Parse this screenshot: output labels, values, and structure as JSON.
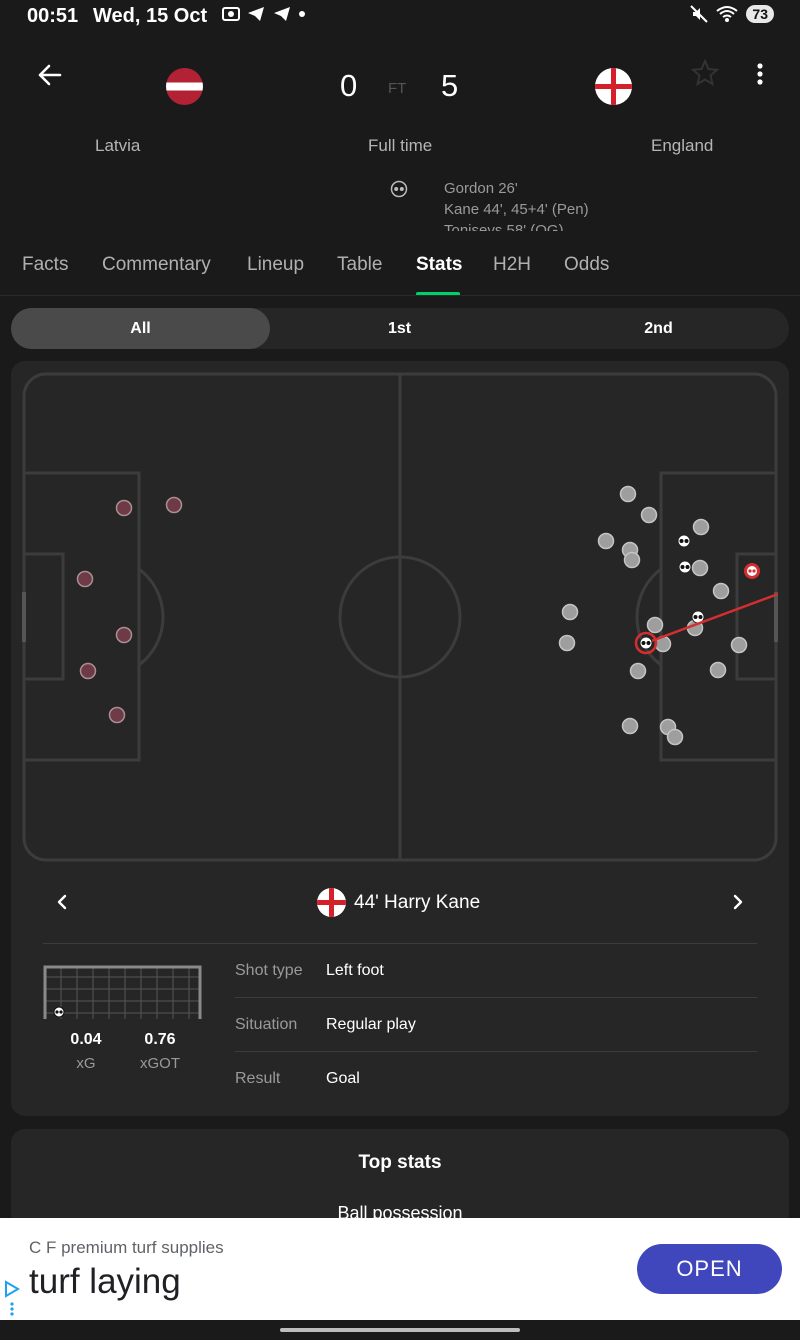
{
  "status_bar": {
    "time": "00:51",
    "date": "Wed, 15 Oct",
    "battery": "73"
  },
  "match": {
    "home_team": "Latvia",
    "away_team": "England",
    "home_score": "0",
    "away_score": "5",
    "status_short": "FT",
    "status_long": "Full time",
    "scorers": [
      "Gordon 26'",
      "Kane 44', 45+4' (Pen)",
      "Tonisevs 58' (OG)"
    ]
  },
  "tabs": [
    "Facts",
    "Commentary",
    "Lineup",
    "Table",
    "Stats",
    "H2H",
    "Odds"
  ],
  "active_tab": "Stats",
  "period_filter": {
    "options": [
      "All",
      "1st",
      "2nd"
    ],
    "selected": "All"
  },
  "shot_map": {
    "home_color": "#6e3a45",
    "away_color": "#9e9e9e",
    "selected_color": "#d32f2f"
  },
  "selected_shot": {
    "title": "44' Harry Kane",
    "xg_value": "0.04",
    "xg_label": "xG",
    "xgot_value": "0.76",
    "xgot_label": "xGOT",
    "details": [
      {
        "label": "Shot type",
        "value": "Left foot"
      },
      {
        "label": "Situation",
        "value": "Regular play"
      },
      {
        "label": "Result",
        "value": "Goal"
      }
    ]
  },
  "top_stats": {
    "title": "Top stats",
    "first_stat": "Ball possession"
  },
  "ad": {
    "sponsor": "C F premium turf supplies",
    "headline": "turf laying",
    "button": "OPEN"
  },
  "icons": {
    "back": "arrow-left-icon",
    "favorite": "star-outline-icon",
    "more": "more-vertical-icon",
    "goal": "football-icon",
    "prev": "chevron-left-icon",
    "next": "chevron-right-icon"
  }
}
